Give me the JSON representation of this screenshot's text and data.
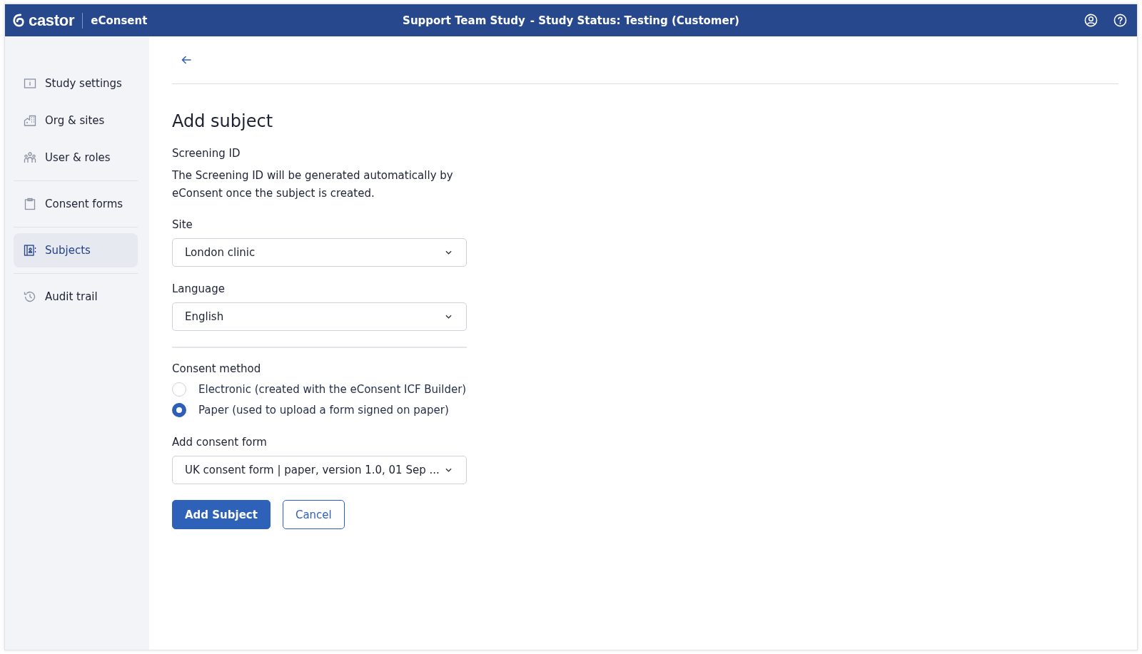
{
  "header": {
    "logo": "castor",
    "product": "eConsent",
    "study_title": "Support Team Study",
    "study_status": "- Study Status: Testing (Customer)"
  },
  "sidebar": {
    "groups": [
      {
        "items": [
          {
            "label": "Study settings",
            "selected": false
          },
          {
            "label": "Org & sites",
            "selected": false
          },
          {
            "label": "User & roles",
            "selected": false
          }
        ]
      },
      {
        "items": [
          {
            "label": "Consent forms",
            "selected": false
          }
        ]
      },
      {
        "items": [
          {
            "label": "Subjects",
            "selected": true
          }
        ]
      },
      {
        "items": [
          {
            "label": "Audit trail",
            "selected": false
          }
        ]
      }
    ]
  },
  "form": {
    "title": "Add subject",
    "screening": {
      "label": "Screening ID",
      "text": "The Screening ID will be generated automatically by eConsent once the subject is created."
    },
    "site": {
      "label": "Site",
      "value": "London clinic"
    },
    "language": {
      "label": "Language",
      "value": "English"
    },
    "consent_method": {
      "label": "Consent method",
      "options": [
        {
          "label": "Electronic (created with the eConsent ICF Builder)",
          "selected": false
        },
        {
          "label": "Paper (used to upload a form signed on paper)",
          "selected": true
        }
      ]
    },
    "consent_form": {
      "label": "Add consent form",
      "value": "UK consent form | paper, version 1.0, 01 Sep ..."
    },
    "buttons": [
      {
        "label": "Add Subject",
        "kind": "primary"
      },
      {
        "label": "Cancel",
        "kind": "secondary"
      }
    ]
  }
}
